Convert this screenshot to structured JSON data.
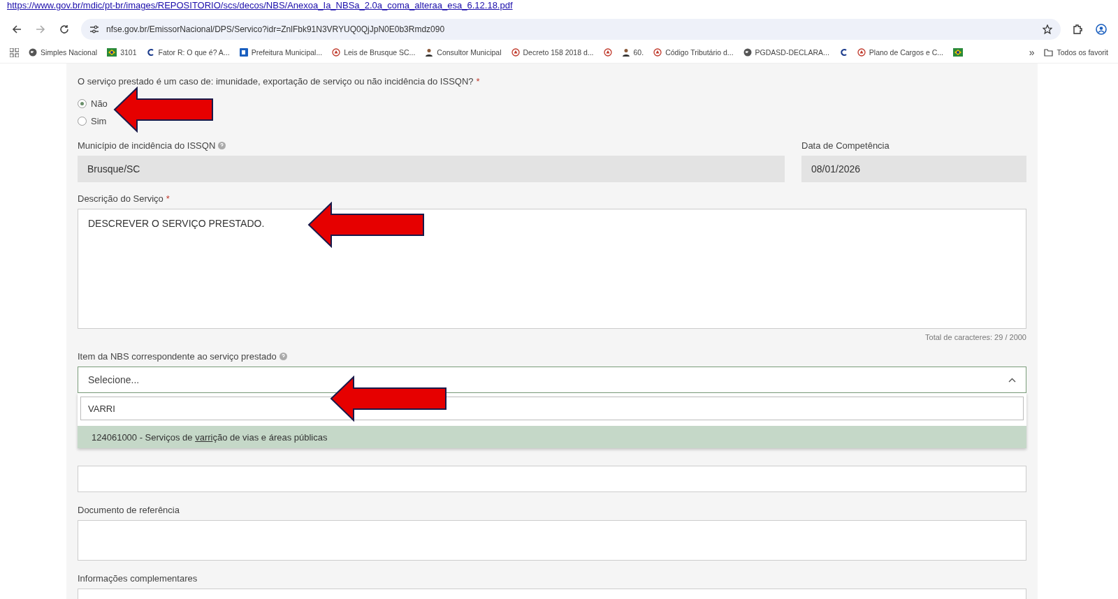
{
  "top_link": "https://www.gov.br/mdic/pt-br/images/REPOSITORIO/scs/decos/NBS/Anexoa_Ia_NBSa_2.0a_coma_alteraa_esa_6.12.18.pdf",
  "address_bar": {
    "url": "nfse.gov.br/EmissorNacional/DPS/Servico?idr=ZnlFbk91N3VRYUQ0QjJpN0E0b3Rmdz090"
  },
  "bookmarks": [
    {
      "kind": "globe",
      "label": "Simples Nacional"
    },
    {
      "kind": "flag",
      "label": "3101"
    },
    {
      "kind": "letter",
      "label": "Fator R: O que é? A..."
    },
    {
      "kind": "square",
      "label": "Prefeitura Municipal..."
    },
    {
      "kind": "ring",
      "label": "Leis de Brusque SC..."
    },
    {
      "kind": "person",
      "label": "Consultor Municipal"
    },
    {
      "kind": "ring",
      "label": "Decreto 158 2018 d..."
    },
    {
      "kind": "ring"
    },
    {
      "kind": "person",
      "label": "60."
    },
    {
      "kind": "ring",
      "label": "Código Tributário d..."
    },
    {
      "kind": "globe",
      "label": "PGDASD-DECLARA..."
    },
    {
      "kind": "letter"
    },
    {
      "kind": "ring",
      "label": "Plano de Cargos e C..."
    },
    {
      "kind": "flag"
    }
  ],
  "bookmarks_more": "»",
  "all_bookmarks": "Todos os favorit",
  "question": {
    "label": "O serviço prestado é um caso de: imunidade, exportação de serviço ou não incidência do ISSQN?",
    "required": "*",
    "options": [
      {
        "label": "Não",
        "selected": true
      },
      {
        "label": "Sim",
        "selected": false
      }
    ]
  },
  "municipio": {
    "label": "Município de incidência do ISSQN",
    "value": "Brusque/SC"
  },
  "competencia": {
    "label": "Data de Competência",
    "value": "08/01/2026"
  },
  "descricao": {
    "label": "Descrição do Serviço",
    "required": "*",
    "value": "DESCREVER O SERVIÇO PRESTADO.",
    "counter": "Total de caracteres: 29 / 2000"
  },
  "nbs": {
    "label": "Item da NBS correspondente ao serviço prestado",
    "placeholder": "Selecione...",
    "expanded": true,
    "search": "VARRI",
    "options": [
      {
        "before": "124061000 - Serviços de ",
        "match": "varri",
        "after": "ção de vias e áreas públicas",
        "selected": true
      }
    ]
  },
  "referencia": {
    "label": "Documento de referência"
  },
  "complementares": {
    "label": "Informações complementares"
  }
}
